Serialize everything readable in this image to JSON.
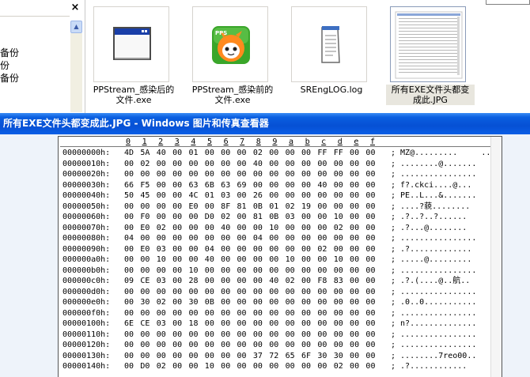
{
  "explorer": {
    "close_glyph": "×",
    "left_items": [
      "备份",
      "份",
      "备份"
    ],
    "scroll_up_glyph": "▲",
    "files": [
      {
        "label": "PPStream_感染后的文件.exe",
        "icon": "window-app-icon"
      },
      {
        "label": "PPStream_感染前的文件.exe",
        "icon": "pps-app-icon",
        "icon_text": "PPS"
      },
      {
        "label": "SREngLOG.log",
        "icon": "notepad-icon"
      },
      {
        "label": "所有EXE文件头都变成此.JPG",
        "icon": "image-thumbnail-icon"
      }
    ]
  },
  "viewer": {
    "title": "所有EXE文件头都变成此.JPG - Windows 图片和传真查看器",
    "hex_header": [
      "0",
      "1",
      "2",
      "3",
      "4",
      "5",
      "6",
      "7",
      "8",
      "9",
      "a",
      "b",
      "c",
      "d",
      "e",
      "f"
    ],
    "hex_rows": [
      {
        "addr": "00000000h:",
        "bytes": "4D 5A 40 00 01 00 00 00 02 00 00 00 FF FF 00 00",
        "ascii": "; MZ@.........     .."
      },
      {
        "addr": "00000010h:",
        "bytes": "00 02 00 00 00 00 00 00 40 00 00 00 00 00 00 00",
        "ascii": "; ........@......."
      },
      {
        "addr": "00000020h:",
        "bytes": "00 00 00 00 00 00 00 00 00 00 00 00 00 00 00 00",
        "ascii": "; ................"
      },
      {
        "addr": "00000030h:",
        "bytes": "66 F5 00 00 63 6B 63 69 00 00 00 00 40 00 00 00",
        "ascii": "; f?.ckci....@..."
      },
      {
        "addr": "00000040h:",
        "bytes": "50 45 00 00 4C 01 03 00 26 00 00 00 00 00 00 00",
        "ascii": "; PE..L...&......."
      },
      {
        "addr": "00000050h:",
        "bytes": "00 00 00 00 E0 00 8F 81 0B 01 02 19 00 00 00 00",
        "ascii": "; ....?藐........"
      },
      {
        "addr": "00000060h:",
        "bytes": "00 F0 00 00 00 D0 02 00 81 0B 03 00 00 10 00 00",
        "ascii": "; .?..?..?......"
      },
      {
        "addr": "00000070h:",
        "bytes": "00 E0 02 00 00 00 40 00 00 10 00 00 00 02 00 00",
        "ascii": "; .?...@........"
      },
      {
        "addr": "00000080h:",
        "bytes": "04 00 00 00 00 00 00 00 04 00 00 00 00 00 00 00",
        "ascii": "; ................"
      },
      {
        "addr": "00000090h:",
        "bytes": "00 E0 03 00 00 04 00 00 00 00 00 00 02 00 00 00",
        "ascii": "; .?............."
      },
      {
        "addr": "000000a0h:",
        "bytes": "00 00 10 00 00 40 00 00 00 00 10 00 00 10 00 00",
        "ascii": "; .....@........."
      },
      {
        "addr": "000000b0h:",
        "bytes": "00 00 00 00 10 00 00 00 00 00 00 00 00 00 00 00",
        "ascii": "; ................"
      },
      {
        "addr": "000000c0h:",
        "bytes": "09 CE 03 00 28 00 00 00 00 40 02 00 F8 83 00 00",
        "ascii": "; .?.(....@..航.."
      },
      {
        "addr": "000000d0h:",
        "bytes": "00 00 00 00 00 00 00 00 00 00 00 00 00 00 00 00",
        "ascii": "; ................"
      },
      {
        "addr": "000000e0h:",
        "bytes": "00 30 02 00 30 0B 00 00 00 00 00 00 00 00 00 00",
        "ascii": "; .0..0..........."
      },
      {
        "addr": "000000f0h:",
        "bytes": "00 00 00 00 00 00 00 00 00 00 00 00 00 00 00 00",
        "ascii": "; ................"
      },
      {
        "addr": "00000100h:",
        "bytes": "6E CE 03 00 18 00 00 00 00 00 00 00 00 00 00 00",
        "ascii": "; n?.............."
      },
      {
        "addr": "00000110h:",
        "bytes": "00 00 00 00 00 00 00 00 00 00 00 00 00 00 00 00",
        "ascii": "; ................"
      },
      {
        "addr": "00000120h:",
        "bytes": "00 00 00 00 00 00 00 00 00 00 00 00 00 00 00 00",
        "ascii": "; ................"
      },
      {
        "addr": "00000130h:",
        "bytes": "00 00 00 00 00 00 00 00 37 72 65 6F 30 30 00 00",
        "ascii": "; ........7reo00.."
      },
      {
        "addr": "00000140h:",
        "bytes": "00 D0 02 00 00 10 00 00 00 00 00 00 00 02 00 00",
        "ascii": "; .?............"
      }
    ]
  }
}
